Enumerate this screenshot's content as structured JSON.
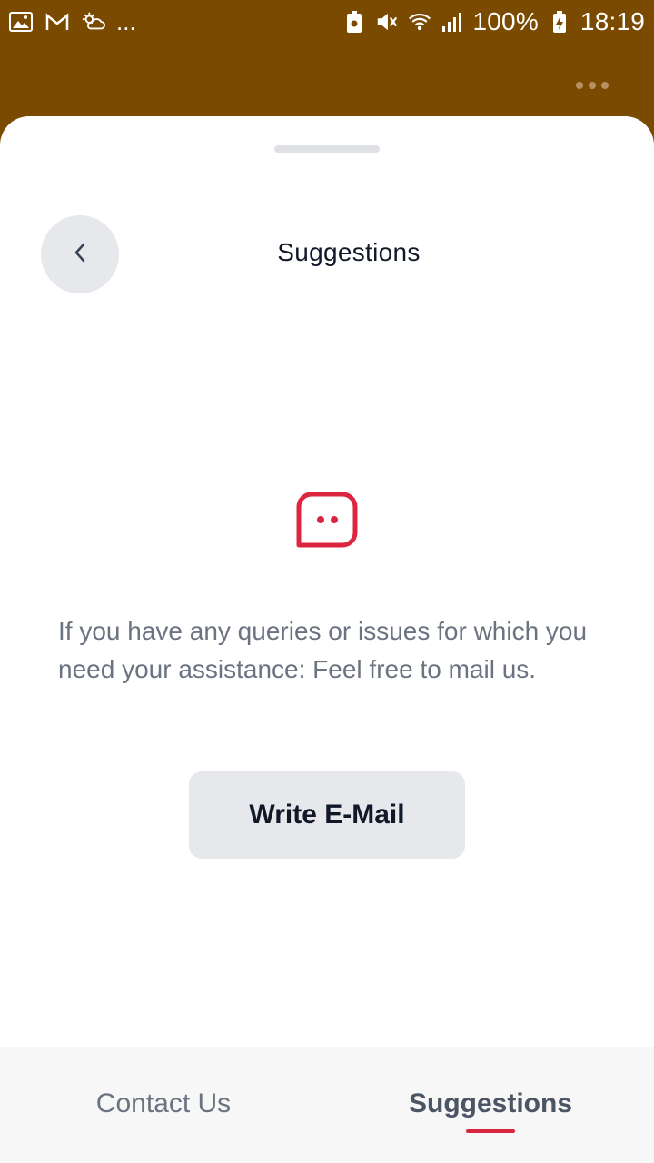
{
  "status_bar": {
    "battery": "100%",
    "time": "18:19",
    "overflow_dots": "..."
  },
  "sheet": {
    "title": "Suggestions",
    "message": "If you have any queries or issues for which you need your assistance: Feel free to mail us.",
    "button_label": "Write E-Mail"
  },
  "tabs": [
    {
      "label": "Contact Us",
      "active": false
    },
    {
      "label": "Suggestions",
      "active": true
    }
  ],
  "colors": {
    "header": "#7a4a00",
    "accent": "#dc2640",
    "button_bg": "#e6e8eb"
  },
  "icons": {
    "back": "chevron-left-icon",
    "message": "chat-bubble-icon",
    "menu": "more-horizontal-icon"
  }
}
